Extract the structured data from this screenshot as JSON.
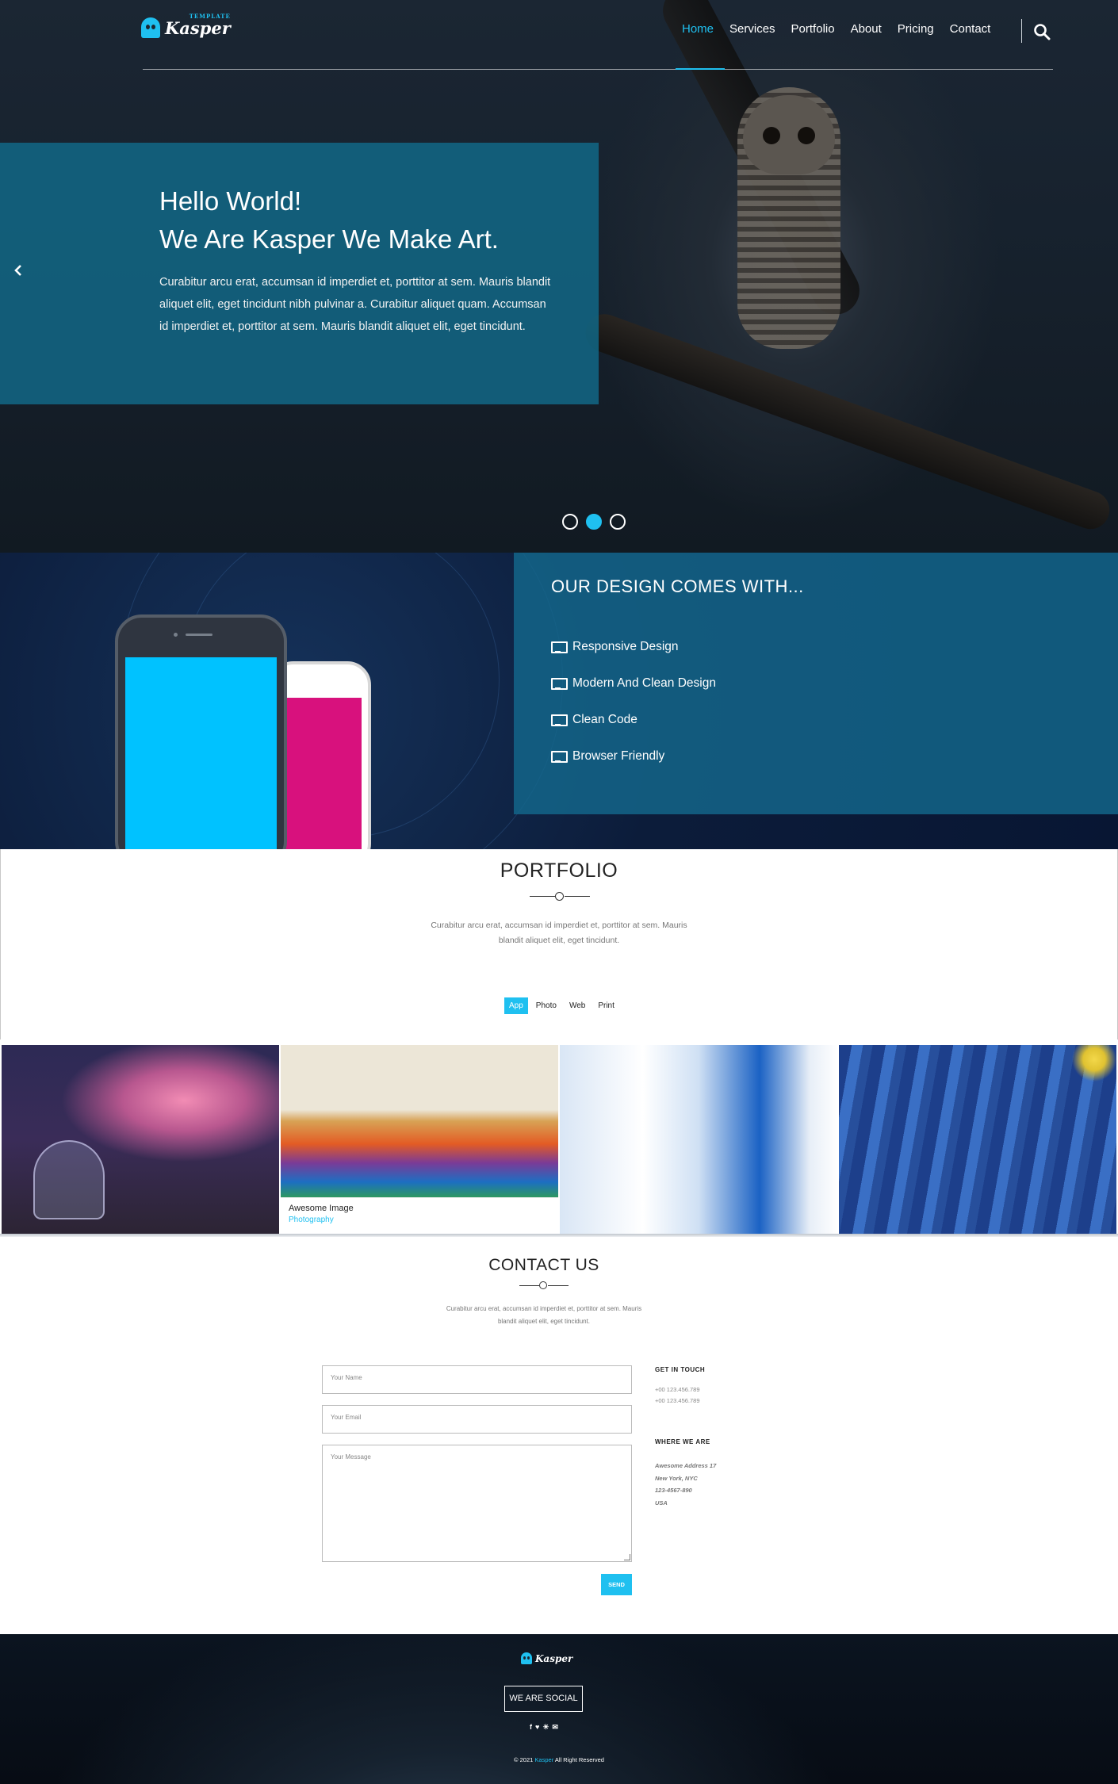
{
  "header": {
    "logo_text": "Kasper",
    "logo_tagline": "TEMPLATE",
    "nav": [
      "Home",
      "Services",
      "Portfolio",
      "About",
      "Pricing",
      "Contact"
    ],
    "active_nav": "Home"
  },
  "hero": {
    "title_line1": "Hello World!",
    "title_line2": "We Are Kasper We Make Art.",
    "description": "Curabitur arcu erat, accumsan id imperdiet et, porttitor at sem. Mauris blandit aliquet elit, eget tincidunt nibh pulvinar a. Curabitur aliquet quam. Accumsan id imperdiet et, porttitor at sem. Mauris blandit aliquet elit, eget tincidunt.",
    "slides_total": 3,
    "active_slide": 2
  },
  "design": {
    "title": "OUR DESIGN COMES WITH...",
    "features": [
      "Responsive Design",
      "Modern And Clean Design",
      "Clean Code",
      "Browser Friendly"
    ]
  },
  "portfolio": {
    "title": "PORTFOLIO",
    "text_line1": "Curabitur arcu erat, accumsan id imperdiet et, porttitor at sem. Mauris",
    "text_line2": "blandit aliquet elit, eget tincidunt.",
    "tabs": [
      "App",
      "Photo",
      "Web",
      "Print"
    ],
    "active_tab": "App",
    "caption_title": "Awesome Image",
    "caption_category": "Photography"
  },
  "contact": {
    "title": "CONTACT US",
    "text_line1": "Curabitur arcu erat, accumsan id imperdiet et, porttitor at sem. Mauris",
    "text_line2": "blandit aliquet elit, eget tincidunt.",
    "name_placeholder": "Your Name",
    "email_placeholder": "Your Email",
    "message_placeholder": "Your Message",
    "send_label": "SEND",
    "get_in_touch": "GET IN TOUCH",
    "phones": [
      "+00 123.456.789",
      "+00 123.456.789"
    ],
    "where_we_are": "WHERE WE ARE",
    "address": [
      "Awesome Address 17",
      "New York, NYC",
      "123-4567-890",
      "USA"
    ]
  },
  "footer": {
    "logo_text": "Kasper",
    "social_label": "WE ARE SOCIAL",
    "social_icons": [
      "f",
      "♥",
      "☀",
      "✉"
    ],
    "copyright_prefix": "© 2021",
    "copyright_brand": "Kasper",
    "copyright_suffix": "All Right Reserved"
  },
  "colors": {
    "accent": "#1fc0f0",
    "hero_box": "#126786",
    "feature_box": "#14688c",
    "footer_bg": "#0b1420"
  }
}
